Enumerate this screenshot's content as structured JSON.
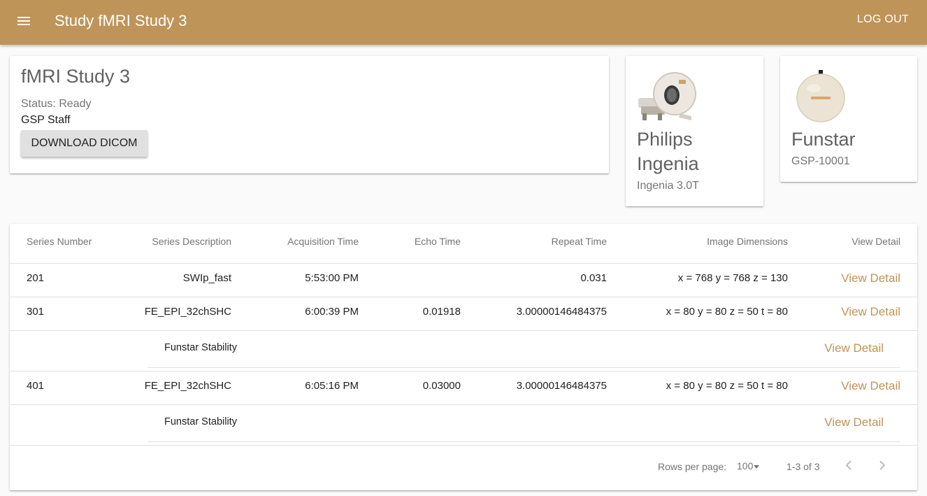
{
  "app_bar": {
    "title": "Study fMRI Study 3",
    "logout_label": "LOG OUT"
  },
  "study": {
    "title": "fMRI Study 3",
    "status": "Status: Ready",
    "owner": "GSP Staff",
    "download_label": "DOWNLOAD DICOM"
  },
  "scanner": {
    "name": "Philips Ingenia",
    "model": "Ingenia 3.0T"
  },
  "phantom": {
    "name": "Funstar",
    "id": "GSP-10001"
  },
  "table": {
    "headers": {
      "series_number": "Series Number",
      "series_description": "Series Description",
      "acquisition_time": "Acquisition Time",
      "echo_time": "Echo Time",
      "repeat_time": "Repeat Time",
      "image_dimensions": "Image Dimensions",
      "view_detail": "View Detail"
    },
    "rows": [
      {
        "series_number": "201",
        "series_description": "SWIp_fast",
        "acquisition_time": "5:53:00 PM",
        "echo_time": "",
        "repeat_time": "0.031",
        "image_dimensions": "x = 768 y = 768 z = 130",
        "view_detail": "View Detail"
      },
      {
        "series_number": "301",
        "series_description": "FE_EPI_32chSHC",
        "acquisition_time": "6:00:39 PM",
        "echo_time": "0.01918",
        "repeat_time": "3.00000146484375",
        "image_dimensions": "x = 80 y = 80 z = 50 t = 80",
        "view_detail": "View Detail",
        "sub": {
          "label": "Funstar Stability",
          "view_detail": "View Detail"
        }
      },
      {
        "series_number": "401",
        "series_description": "FE_EPI_32chSHC",
        "acquisition_time": "6:05:16 PM",
        "echo_time": "0.03000",
        "repeat_time": "3.00000146484375",
        "image_dimensions": "x = 80 y = 80 z = 50 t = 80",
        "view_detail": "View Detail",
        "sub": {
          "label": "Funstar Stability",
          "view_detail": "View Detail"
        }
      }
    ],
    "footer": {
      "rows_per_page_label": "Rows per page:",
      "rows_per_page_value": "100",
      "range": "1-3 of 3"
    }
  },
  "colors": {
    "app_bar": "#bf9458",
    "link": "#bf9458"
  },
  "icons": {
    "menu": "menu-icon",
    "prev": "chevron-left-icon",
    "next": "chevron-right-icon",
    "dropdown": "arrow-drop-down-icon"
  }
}
